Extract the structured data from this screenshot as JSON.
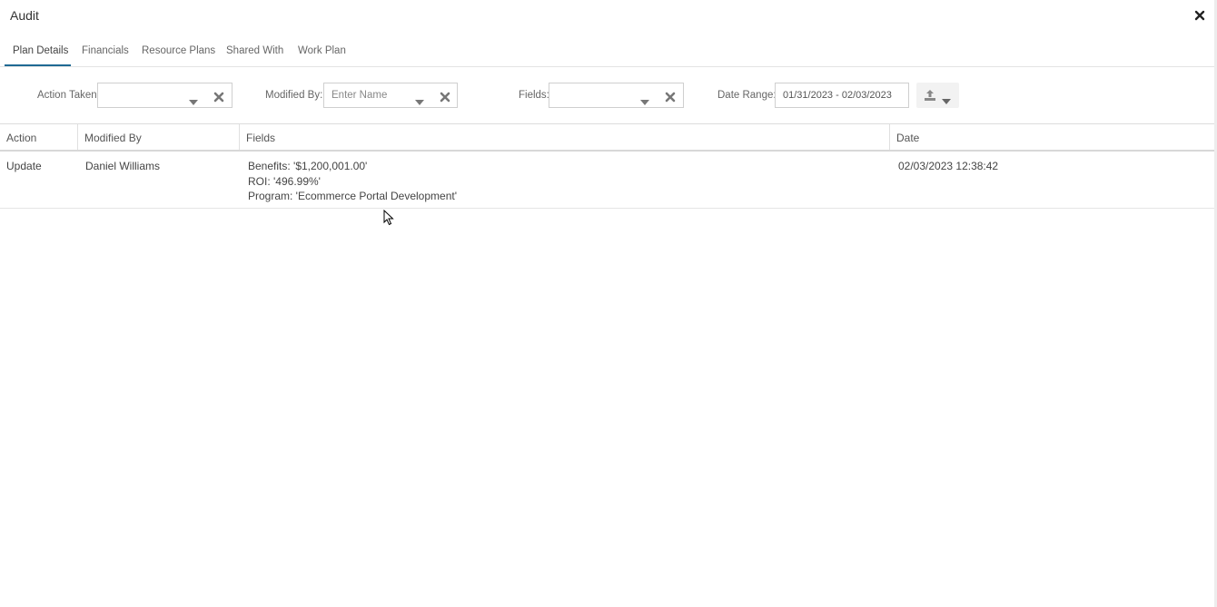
{
  "window": {
    "title": "Audit"
  },
  "tabs": [
    {
      "label": "Plan Details",
      "active": true
    },
    {
      "label": "Financials"
    },
    {
      "label": "Resource Plans"
    },
    {
      "label": "Shared With"
    },
    {
      "label": "Work Plan"
    }
  ],
  "filters": {
    "action_taken": {
      "label": "Action Taken:",
      "value": ""
    },
    "modified_by": {
      "label": "Modified By:",
      "placeholder": "Enter Name"
    },
    "fields": {
      "label": "Fields:",
      "value": ""
    },
    "date_range": {
      "label": "Date Range:",
      "value": "01/31/2023 - 02/03/2023"
    }
  },
  "grid": {
    "columns": [
      "Action",
      "Modified By",
      "Fields",
      "Date"
    ],
    "rows": [
      {
        "action": "Update",
        "modified_by": "Daniel Williams",
        "fields": [
          "Benefits: '$1,200,001.00'",
          "ROI: '496.99%'",
          "Program: 'Ecommerce Portal Development'"
        ],
        "date": "02/03/2023 12:38:42"
      }
    ]
  },
  "colors": {
    "accent": "#1f6a93"
  }
}
